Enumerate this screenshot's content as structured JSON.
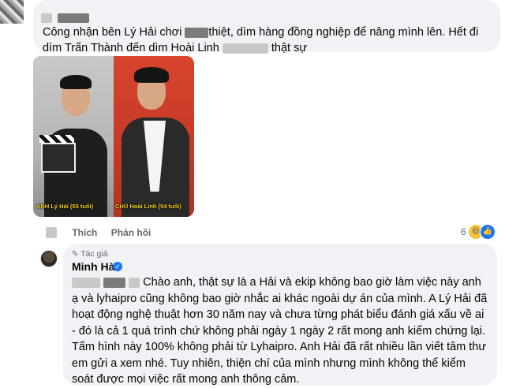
{
  "top_comment": {
    "text_before": "Công nhận bên Lý Hải chơi",
    "text_mid": "thiệt, dìm hàng đồng nghiệp để nâng mình lên. Hết đi dìm Trấn Thành đến dìm Hoài Linh",
    "text_end": "thật sự"
  },
  "image": {
    "caption_left": "ANH Lý Hải (55 tuổi)",
    "caption_right": "CHÚ Hoài Linh (54 tuổi)"
  },
  "actions": {
    "like_label": "Thích",
    "reply_label": "Phản hồi",
    "reaction_count": "6"
  },
  "reply": {
    "author_tag": "Tác giả",
    "name": "Minh Hà",
    "text_first": "Chào anh, thật sự là a Hải và ekip không bao giờ làm việc này anh ạ và lyhaipro cũng không bao giờ nhắc ai khác ngoài dự án của mình. A Lý Hải đã hoạt động nghệ thuật hơn 30 năm nay và chưa từng phát biểu đánh giá xấu về ai - đó là cả 1 quá trình chứ không phải ngày 1 ngày 2 rất mong anh kiểm chứng lại. Tấm hình này 100% không phải từ Lyhaipro. Anh Hải đã rất nhiều lần viết tâm thư em gửi a xem nhé. Tuy nhiên, thiện chí của mình nhưng mình không thể kiểm soát được mọi việc rất mong anh thông cảm."
  },
  "colors": {
    "bubble": "#f0f2f5",
    "secondary_text": "#65676b",
    "verified": "#1877f2",
    "caption": "#f7d21a"
  }
}
